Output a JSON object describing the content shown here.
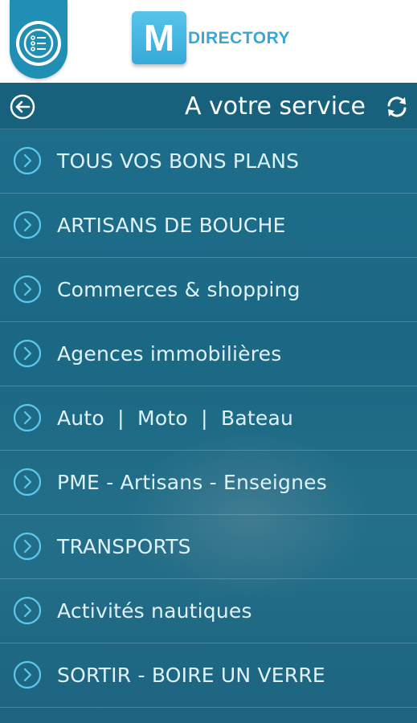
{
  "app": {
    "logo_letter": "M",
    "logo_word": "DIRECTORY",
    "menu_icon": "list-icon"
  },
  "header": {
    "title": "A votre service",
    "back_icon": "back-arrow-icon",
    "refresh_icon": "refresh-icon"
  },
  "colors": {
    "accent": "#1f8fb3",
    "background": "#1b6884",
    "text": "#dff2f9"
  },
  "items": [
    {
      "label": "TOUS VOS BONS PLANS",
      "icon": "chevron-right-icon"
    },
    {
      "label": "ARTISANS DE BOUCHE",
      "icon": "chevron-right-icon"
    },
    {
      "label": "Commerces & shopping",
      "icon": "chevron-right-icon"
    },
    {
      "label": "Agences immobilières",
      "icon": "chevron-right-icon"
    },
    {
      "label": "Auto  |  Moto  |  Bateau",
      "icon": "chevron-right-icon"
    },
    {
      "label": "PME - Artisans - Enseignes",
      "icon": "chevron-right-icon"
    },
    {
      "label": "TRANSPORTS",
      "icon": "chevron-right-icon"
    },
    {
      "label": "Activités nautiques",
      "icon": "chevron-right-icon"
    },
    {
      "label": "SORTIR - BOIRE UN VERRE",
      "icon": "chevron-right-icon"
    }
  ]
}
